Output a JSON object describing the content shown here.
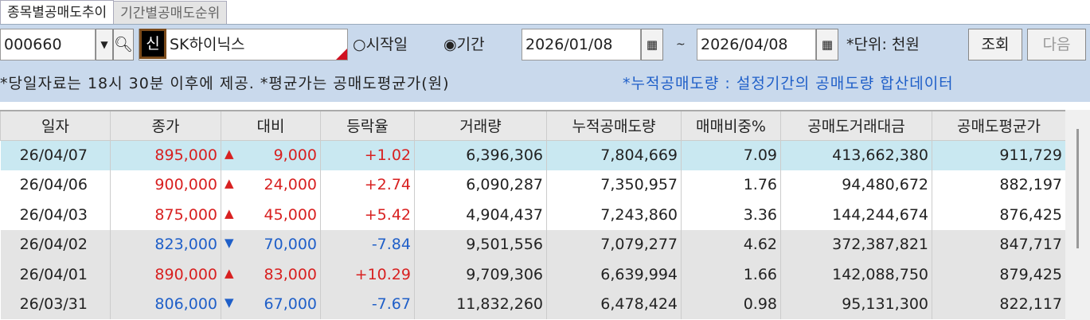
{
  "tabs": [
    "종목별공매도추이",
    "기간별공매도순위"
  ],
  "toolbar": {
    "code": "000660",
    "badge": "신",
    "name": "SK하이닉스",
    "radio_start": "시작일",
    "radio_period": "기간",
    "date_from": "2026/01/08",
    "tilde": "~",
    "date_to": "2026/04/08",
    "unit": "*단위: 천원",
    "search": "조회",
    "next": "다음"
  },
  "notes": {
    "left": "*당일자료는 18시 30분 이후에 제공. *평균가는 공매도평균가(원)",
    "right": "*누적공매도량 : 설정기간의 공매도량 합산데이터"
  },
  "columns": [
    "일자",
    "종가",
    "대비",
    "등락율",
    "거래량",
    "누적공매도량",
    "매매비중%",
    "공매도거래대금",
    "공매도평균가"
  ],
  "rows": [
    {
      "date": "26/04/07",
      "close": "895,000",
      "dir": "up",
      "change": "9,000",
      "rate": "+1.02",
      "volume": "6,396,306",
      "cum": "7,804,669",
      "ratio": "7.09",
      "amount": "413,662,380",
      "avg": "911,729"
    },
    {
      "date": "26/04/06",
      "close": "900,000",
      "dir": "up",
      "change": "24,000",
      "rate": "+2.74",
      "volume": "6,090,287",
      "cum": "7,350,957",
      "ratio": "1.76",
      "amount": "94,480,672",
      "avg": "882,197"
    },
    {
      "date": "26/04/03",
      "close": "875,000",
      "dir": "up",
      "change": "45,000",
      "rate": "+5.42",
      "volume": "4,904,437",
      "cum": "7,243,860",
      "ratio": "3.36",
      "amount": "144,244,674",
      "avg": "876,425"
    },
    {
      "date": "26/04/02",
      "close": "823,000",
      "dir": "down",
      "change": "70,000",
      "rate": "-7.84",
      "volume": "9,501,556",
      "cum": "7,079,277",
      "ratio": "4.62",
      "amount": "372,387,821",
      "avg": "847,717"
    },
    {
      "date": "26/04/01",
      "close": "890,000",
      "dir": "up",
      "change": "83,000",
      "rate": "+10.29",
      "volume": "9,709,306",
      "cum": "6,639,994",
      "ratio": "1.66",
      "amount": "142,088,750",
      "avg": "879,425"
    },
    {
      "date": "26/03/31",
      "close": "806,000",
      "dir": "down",
      "change": "67,000",
      "rate": "-7.67",
      "volume": "11,832,260",
      "cum": "6,478,424",
      "ratio": "0.98",
      "amount": "95,131,300",
      "avg": "822,117"
    }
  ]
}
